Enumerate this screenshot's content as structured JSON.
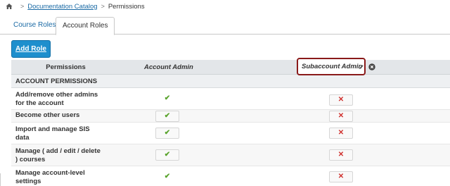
{
  "breadcrumb": {
    "home_icon": "home-icon",
    "separator": ">",
    "items": [
      {
        "label": "Documentation Catalog"
      },
      {
        "label": "Permissions"
      }
    ]
  },
  "tabs": [
    {
      "label": "Course Roles",
      "active": false
    },
    {
      "label": "Account Roles",
      "active": true
    }
  ],
  "toolbar": {
    "add_role_label": "Add Role"
  },
  "table": {
    "header": {
      "permissions": "Permissions",
      "roles": [
        "Account Admin",
        "Subaccount Admin"
      ]
    },
    "section": "ACCOUNT PERMISSIONS",
    "rows": [
      {
        "label_lines": [
          "Add/remove other admins",
          "for the account"
        ],
        "values": [
          "✔",
          "✕"
        ]
      },
      {
        "label_lines": [
          "Become other users",
          ""
        ],
        "values": [
          "✔",
          "✕"
        ]
      },
      {
        "label_lines": [
          "Import and manage SIS",
          "data"
        ],
        "values": [
          "✔",
          "✕"
        ]
      },
      {
        "label_lines": [
          "Manage ( add / edit / delete",
          ") courses"
        ],
        "values": [
          "✔",
          "✕"
        ]
      },
      {
        "label_lines": [
          "Manage account-level",
          "settings"
        ],
        "values": [
          "✔",
          "✕"
        ]
      }
    ]
  },
  "colors": {
    "accent": "#1e8fcd",
    "link": "#1a6aa5",
    "highlight_border": "#8a1a1a",
    "check": "#59a32c",
    "cross": "#d0322f"
  }
}
